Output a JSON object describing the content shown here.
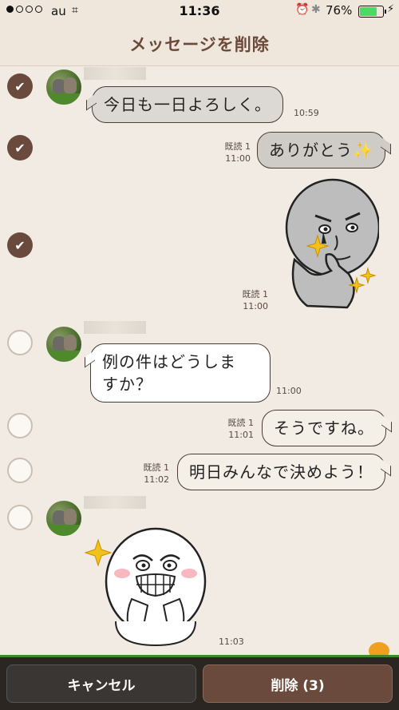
{
  "status_bar": {
    "carrier": "au",
    "time": "11:36",
    "battery": "76%",
    "battery_level": 0.76
  },
  "header": {
    "title": "メッセージを削除"
  },
  "messages": [
    {
      "text": "今日も一日よろしく。",
      "time": "10:59",
      "read": "",
      "direction": "in",
      "selected": true
    },
    {
      "text": "ありがとう✨",
      "time": "11:00",
      "read": "既読 1",
      "direction": "out",
      "selected": true
    },
    {
      "text": "",
      "time": "11:00",
      "read": "既読 1",
      "direction": "out",
      "selected": true,
      "sticker": "moon-sticker"
    },
    {
      "text": "例の件はどうしますか？",
      "line1": "例の件はどうしますか？",
      "time": "11:00",
      "read": "",
      "direction": "in",
      "selected": false
    },
    {
      "text": "そうですね。",
      "time": "11:01",
      "read": "既読 1",
      "direction": "out",
      "selected": false
    },
    {
      "text": "明日みんなで決めよう！",
      "time": "11:02",
      "read": "既読 1",
      "direction": "out",
      "selected": false
    },
    {
      "text": "",
      "time": "11:03",
      "read": "",
      "direction": "in",
      "selected": false,
      "sticker": "moon-laughing-sticker"
    }
  ],
  "bubble_lines": {
    "m3_line1": "例の件はどうしま",
    "m3_line2": "すか？"
  },
  "buttons": {
    "cancel": "キャンセル",
    "delete": "削除 (3)"
  },
  "colors": {
    "accent": "#6a4a3c",
    "background": "#f1ebe3",
    "bottom_bar": "#2c2622"
  }
}
